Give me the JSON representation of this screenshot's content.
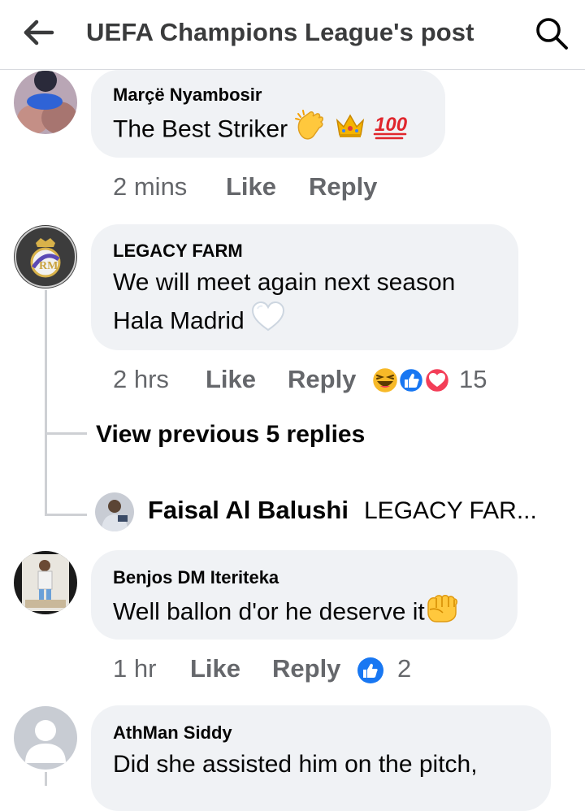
{
  "header": {
    "title": "UEFA Champions League's post"
  },
  "comments": [
    {
      "author": "Marçë Nyambosir",
      "text": "The Best Striker",
      "emojis": [
        "clapping-hands",
        "crown",
        "hundred-points"
      ],
      "time": "2 mins",
      "like_label": "Like",
      "reply_label": "Reply"
    },
    {
      "author": "LEGACY FARM",
      "text_line1": "We will meet again next season",
      "text_line2": "Hala Madrid",
      "emojis": [
        "white-heart"
      ],
      "time": "2 hrs",
      "like_label": "Like",
      "reply_label": "Reply",
      "reactions": [
        "haha",
        "like",
        "love"
      ],
      "reaction_count": "15",
      "view_previous": "View previous 5 replies",
      "latest_reply": {
        "author": "Faisal Al Balushi",
        "preview": "LEGACY FAR..."
      }
    },
    {
      "author": "Benjos DM Iteriteka",
      "text": "Well ballon d'or he deserve it",
      "emojis": [
        "oncoming-fist"
      ],
      "time": "1 hr",
      "like_label": "Like",
      "reply_label": "Reply",
      "reactions": [
        "like"
      ],
      "reaction_count": "2"
    },
    {
      "author": "AthMan Siddy",
      "text": "Did she assisted him on the pitch,"
    }
  ],
  "colors": {
    "bubble": "#f0f2f5",
    "secondary_text": "#65676b",
    "like_blue": "#1877f2",
    "love_red": "#f33e58",
    "haha_yellow": "#f7b928"
  }
}
